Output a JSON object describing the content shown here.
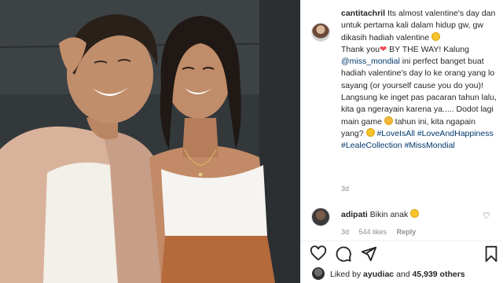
{
  "post": {
    "author": "cantitachril",
    "caption_parts": {
      "p1": "Its almost valentine's day dan untuk pertama kali dalam hidup gw, gw dikasih hadiah valentine",
      "p2": "Thank you",
      "p3": "BY THE WAY! Kalung",
      "mention": "@miss_mondial",
      "p4": "ini perfect banget buat hadiah valentine's day lo ke orang yang lo sayang (or yourself cause you do you)! Langsung ke inget pas pacaran tahun lalu, kita ga ngerayain karena ya..... Dodot lagi main game",
      "p5": "tahun ini, kita ngapain yang?",
      "tag1": "#LoveIsAll",
      "tag2": "#LoveAndHappiness",
      "tag3": "#LealeCollection",
      "tag4": "#MissMondial"
    },
    "time": "3d"
  },
  "comment": {
    "author": "adipati",
    "text": "Bikin anak",
    "time": "3d",
    "likes": "544 likes",
    "reply": "Reply"
  },
  "likes_line": {
    "prefix": "Liked by",
    "user": "ayudiac",
    "and": "and",
    "count": "45,939 others"
  },
  "icons": [
    "heart-icon",
    "comment-icon",
    "share-icon",
    "bookmark-icon"
  ]
}
